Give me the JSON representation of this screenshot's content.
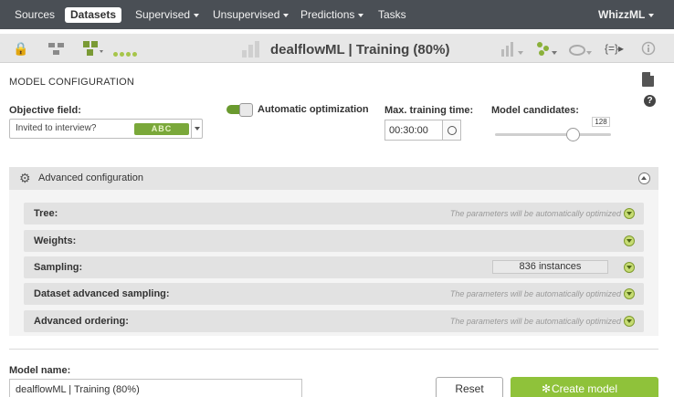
{
  "nav": {
    "items": [
      {
        "label": "Sources",
        "active": false,
        "caret": false
      },
      {
        "label": "Datasets",
        "active": true,
        "caret": false
      },
      {
        "label": "Supervised",
        "active": false,
        "caret": true
      },
      {
        "label": "Unsupervised",
        "active": false,
        "caret": true
      },
      {
        "label": "Predictions",
        "active": false,
        "caret": true
      },
      {
        "label": "Tasks",
        "active": false,
        "caret": false
      }
    ],
    "user": "WhizzML"
  },
  "toolbar": {
    "title": "dealflowML | Training (80%)",
    "icons": [
      "lock-icon",
      "network-icon",
      "tree-model-icon",
      "status-dots-icon",
      "bar-chart-icon",
      "chart-menu-icon",
      "model-menu-icon",
      "cloud-icon",
      "formula-icon",
      "info-icon"
    ]
  },
  "config": {
    "title": "MODEL CONFIGURATION",
    "objective_label": "Objective field:",
    "objective_value": "Invited to interview?",
    "objective_type": "ABC",
    "auto_opt_label": "Automatic optimization",
    "auto_opt_on": true,
    "max_time_label": "Max. training time:",
    "max_time_value": "00:30:00",
    "candidates_label": "Model candidates:",
    "candidates_value": "128",
    "candidates_fraction": 0.67
  },
  "advanced": {
    "title": "Advanced configuration",
    "rows": [
      {
        "label": "Tree:",
        "note": "The parameters will be automatically optimized"
      },
      {
        "label": "Weights:",
        "note": ""
      },
      {
        "label": "Sampling:",
        "note": "",
        "instances": "836 instances"
      },
      {
        "label": "Dataset advanced sampling:",
        "note": "The parameters will be automatically optimized"
      },
      {
        "label": "Advanced ordering:",
        "note": "The parameters will be automatically optimized"
      }
    ]
  },
  "footer": {
    "model_name_label": "Model name:",
    "model_name_value": "dealflowML | Training (80%)",
    "reset_label": "Reset",
    "create_label": "Create model"
  },
  "colors": {
    "nav_bg": "#4a4f55",
    "accent_green": "#8fc23a"
  }
}
